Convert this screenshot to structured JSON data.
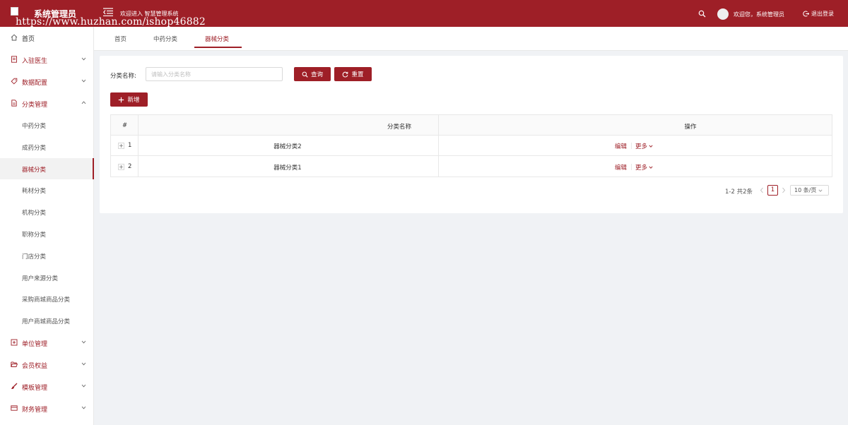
{
  "header": {
    "brand": "系统管理员",
    "watermark": "https://www.huzhan.com/ishop46882",
    "welcome": "欢迎进入 智慧管理系统",
    "greeting": "欢迎您，系统管理员",
    "logout": "退出登录"
  },
  "sidebar": {
    "home": "首页",
    "doctors": "入驻医生",
    "data_config": "数据配置",
    "category_mgmt": "分类管理",
    "sub_items": [
      "中药分类",
      "成药分类",
      "器械分类",
      "耗材分类",
      "机构分类",
      "职称分类",
      "门店分类",
      "用户来源分类",
      "采购商城商品分类",
      "用户商城商品分类"
    ],
    "unit_mgmt": "单位管理",
    "member_benefits": "会员权益",
    "template_mgmt": "模板管理",
    "finance_mgmt": "财务管理"
  },
  "tabs": [
    "首页",
    "中药分类",
    "器械分类"
  ],
  "form": {
    "label": "分类名称:",
    "placeholder": "请输入分类名称",
    "search": "查询",
    "reset": "重置",
    "add": "新增"
  },
  "table": {
    "headers": [
      "#",
      "分类名称",
      "操作"
    ],
    "rows": [
      {
        "index": "1",
        "name": "器械分类2",
        "edit": "编辑",
        "more": "更多"
      },
      {
        "index": "2",
        "name": "器械分类1",
        "edit": "编辑",
        "more": "更多"
      }
    ]
  },
  "pagination": {
    "total": "1-2 共2条",
    "current": "1",
    "page_size": "10 条/页"
  },
  "colors": {
    "primary": "#9e1f27",
    "background": "#f0f2f5"
  }
}
